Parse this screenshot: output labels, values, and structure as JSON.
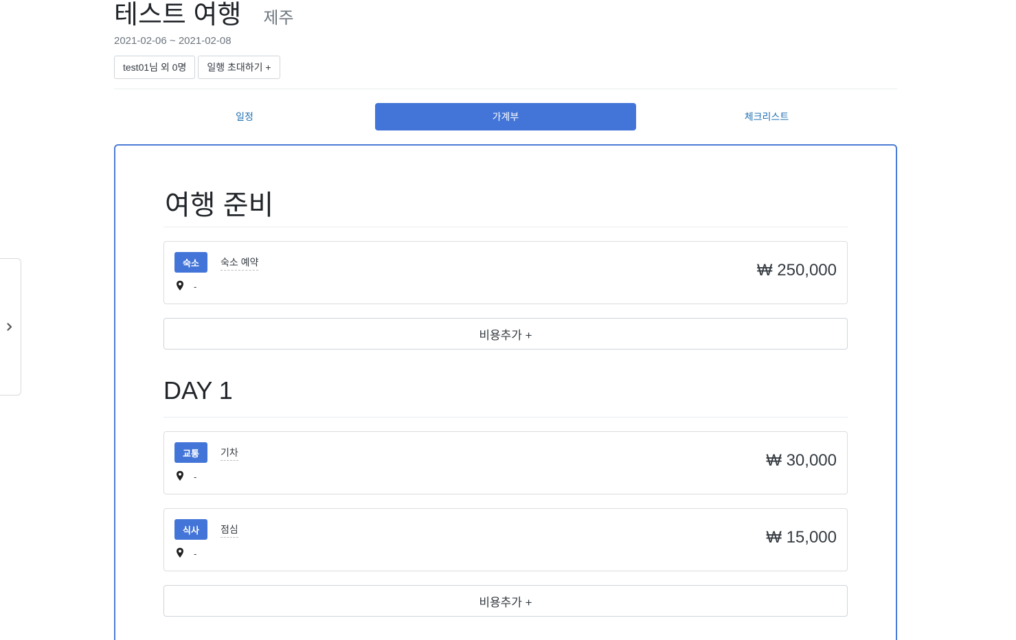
{
  "trip": {
    "title": "테스트 여행",
    "region": "제주",
    "dates": "2021-02-06 ~ 2021-02-08",
    "members_label": "test01님 외 0명",
    "invite_label": "일행 초대하기 +"
  },
  "tabs": [
    {
      "label": "일정",
      "active": false
    },
    {
      "label": "가계부",
      "active": true
    },
    {
      "label": "체크리스트",
      "active": false
    }
  ],
  "sections": [
    {
      "title": "여행 준비",
      "expenses": [
        {
          "category": "숙소",
          "name": "숙소 예약",
          "location": "-",
          "amount": "₩ 250,000"
        }
      ],
      "add_label": "비용추가 +"
    },
    {
      "title": "DAY 1",
      "expenses": [
        {
          "category": "교통",
          "name": "기차",
          "location": "-",
          "amount": "₩ 30,000"
        },
        {
          "category": "식사",
          "name": "점심",
          "location": "-",
          "amount": "₩ 15,000"
        }
      ],
      "add_label": "비용추가 +"
    }
  ],
  "icons": {
    "side_toggle": "chevron-right-icon",
    "location": "map-pin-icon"
  },
  "colors": {
    "accent": "#4375d8",
    "panel_border": "#4a7bd6",
    "tab_link": "#1f6fb2"
  }
}
